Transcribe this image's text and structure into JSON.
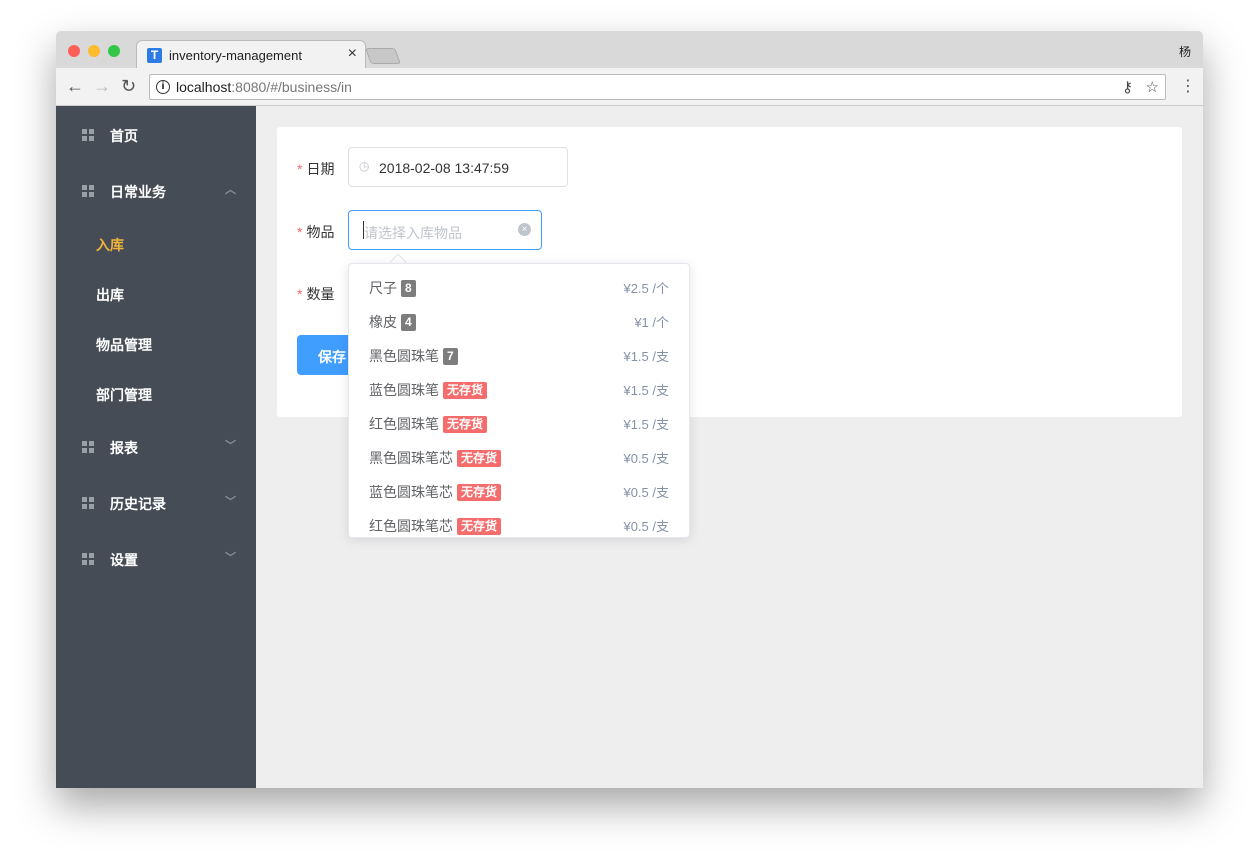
{
  "browser": {
    "tab_title": "inventory-management",
    "user": "杨",
    "url_host": "localhost",
    "url_rest": ":8080/#/business/in"
  },
  "sidebar": {
    "items": [
      {
        "label": "首页",
        "chevron": ""
      },
      {
        "label": "日常业务",
        "chevron": "︿"
      },
      {
        "label": "报表",
        "chevron": "﹀"
      },
      {
        "label": "历史记录",
        "chevron": "﹀"
      },
      {
        "label": "设置",
        "chevron": "﹀"
      }
    ],
    "sub_items": [
      {
        "label": "入库",
        "active": true
      },
      {
        "label": "出库"
      },
      {
        "label": "物品管理"
      },
      {
        "label": "部门管理"
      }
    ],
    "active_color": "#f0b43c"
  },
  "form": {
    "date_label": "日期",
    "date_value": "2018-02-08 13:47:59",
    "item_label": "物品",
    "item_placeholder": "请选择入库物品",
    "qty_label": "数量",
    "save_label": "保存",
    "required": "*"
  },
  "dropdown": {
    "options": [
      {
        "name": "尺子",
        "stock": "8",
        "price": "¥2.5 /个",
        "out": false
      },
      {
        "name": "橡皮",
        "stock": "4",
        "price": "¥1 /个",
        "out": false
      },
      {
        "name": "黑色圆珠笔",
        "stock": "7",
        "price": "¥1.5 /支",
        "out": false
      },
      {
        "name": "蓝色圆珠笔",
        "stock": "无存货",
        "price": "¥1.5 /支",
        "out": true
      },
      {
        "name": "红色圆珠笔",
        "stock": "无存货",
        "price": "¥1.5 /支",
        "out": true
      },
      {
        "name": "黑色圆珠笔芯",
        "stock": "无存货",
        "price": "¥0.5 /支",
        "out": true
      },
      {
        "name": "蓝色圆珠笔芯",
        "stock": "无存货",
        "price": "¥0.5 /支",
        "out": true
      },
      {
        "name": "红色圆珠笔芯",
        "stock": "无存货",
        "price": "¥0.5 /支",
        "out": true
      }
    ]
  },
  "colors": {
    "primary": "#409eff",
    "danger": "#f56c6c",
    "stock_tag": "#7d7d7d"
  }
}
